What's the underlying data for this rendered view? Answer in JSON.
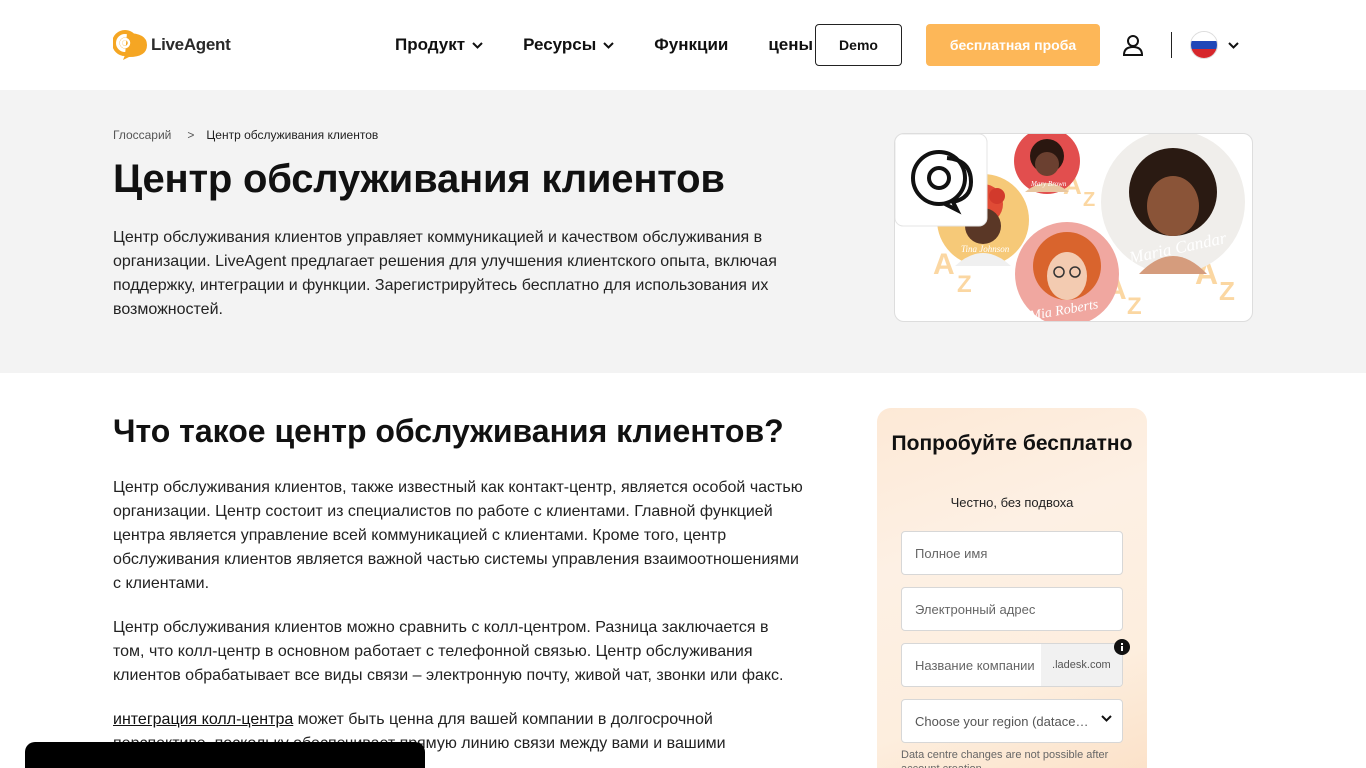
{
  "header": {
    "logo_text": "LiveAgent",
    "nav": [
      {
        "label": "Продукт",
        "has_dropdown": true
      },
      {
        "label": "Ресурсы",
        "has_dropdown": true
      },
      {
        "label": "Функции",
        "has_dropdown": false
      },
      {
        "label": "цены",
        "has_dropdown": false
      }
    ],
    "demo_label": "Demo",
    "trial_label": "бесплатная проба",
    "user_icon": "user-icon",
    "language_flag": "russian-flag"
  },
  "hero": {
    "breadcrumb": {
      "parent": "Глоссарий",
      "separator": ">",
      "current": "Центр обслуживания клиентов"
    },
    "title": "Центр обслуживания клиентов",
    "text": "Центр обслуживания клиентов управляет коммуникацией и качеством обслуживания в организации. LiveAgent предлагает решения для улучшения клиентского опыта, включая поддержку, интеграции и функции. Зарегистрируйтесь бесплатно для использования их возможностей.",
    "image_names": [
      "Mary Brown",
      "Tina Johnson",
      "Maria Candar",
      "Mia Roberts"
    ]
  },
  "main": {
    "title": "Что такое центр обслуживания клиентов?",
    "paragraph1": "Центр обслуживания клиентов, также известный как контакт-центр, является особой частью организации. Центр состоит из специалистов по работе с клиентами. Главной функцией центра является управление всей коммуникацией с клиентами. Кроме того, центр обслуживания клиентов является важной частью системы управления взаимоотношениями с клиентами.",
    "paragraph2": "Центр обслуживания клиентов можно сравнить с колл-центром. Разница заключается в том, что колл-центр в основном работает с телефонной связью. Центр обслуживания клиентов обрабатывает все виды связи – электронную почту, живой чат, звонки или факс.",
    "paragraph3_link": "интеграция колл-центра",
    "paragraph3_rest": " может быть ценна для вашей компании в долгосрочной перспективе, поскольку обеспечивает прямую линию связи между вами и вашими клиентами."
  },
  "signup": {
    "title": "Попробуйте бесплатно",
    "subtitle": "Честно, без подвоха",
    "name_placeholder": "Полное имя",
    "email_placeholder": "Электронный адрес",
    "company_placeholder": "Название компании",
    "company_suffix": ".ladesk.com",
    "region_placeholder": "Choose your region (datacenter)",
    "note": "Data centre changes are not possible after account creation"
  },
  "colors": {
    "accent": "#fdb758",
    "logo_orange": "#f5a623",
    "hero_bg": "#f3f3f3"
  }
}
